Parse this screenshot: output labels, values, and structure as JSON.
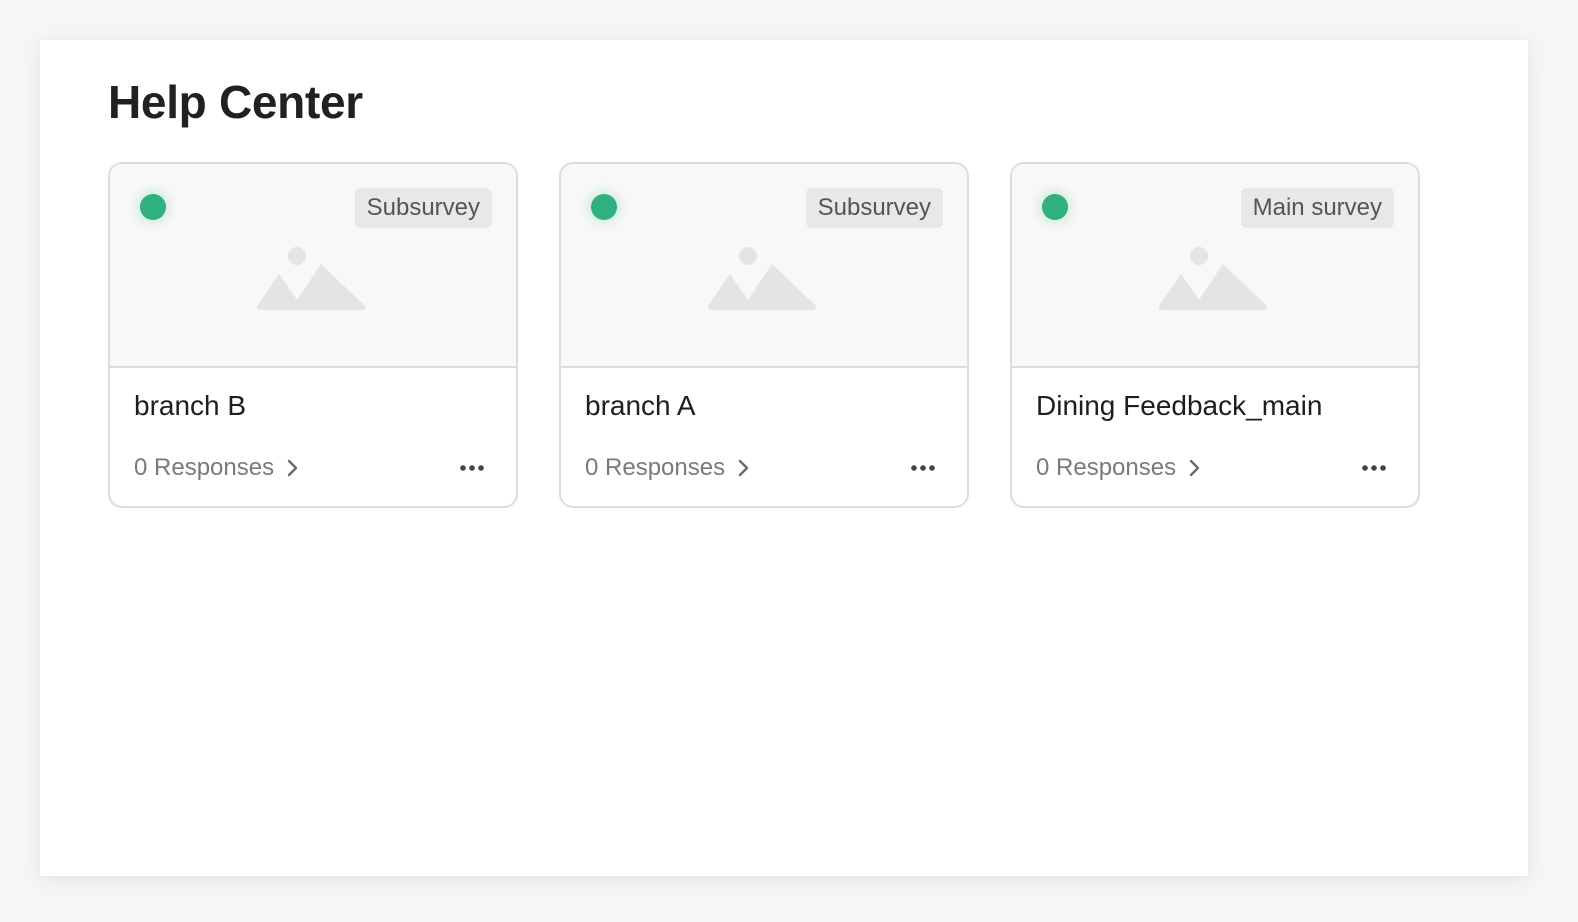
{
  "page": {
    "title": "Help Center"
  },
  "colors": {
    "status_active": "#2fb07e",
    "badge_bg": "#e8e8e8",
    "card_border": "#dcdcdc"
  },
  "cards": [
    {
      "name": "branch B",
      "badge": "Subsurvey",
      "responses": "0 Responses",
      "status": "active",
      "thumbnail_icon": "image-placeholder-icon",
      "more_icon": "more-horizontal-icon"
    },
    {
      "name": "branch A",
      "badge": "Subsurvey",
      "responses": "0 Responses",
      "status": "active",
      "thumbnail_icon": "image-placeholder-icon",
      "more_icon": "more-horizontal-icon"
    },
    {
      "name": "Dining Feedback_main",
      "badge": "Main survey",
      "responses": "0 Responses",
      "status": "active",
      "thumbnail_icon": "image-placeholder-icon",
      "more_icon": "more-horizontal-icon"
    }
  ]
}
